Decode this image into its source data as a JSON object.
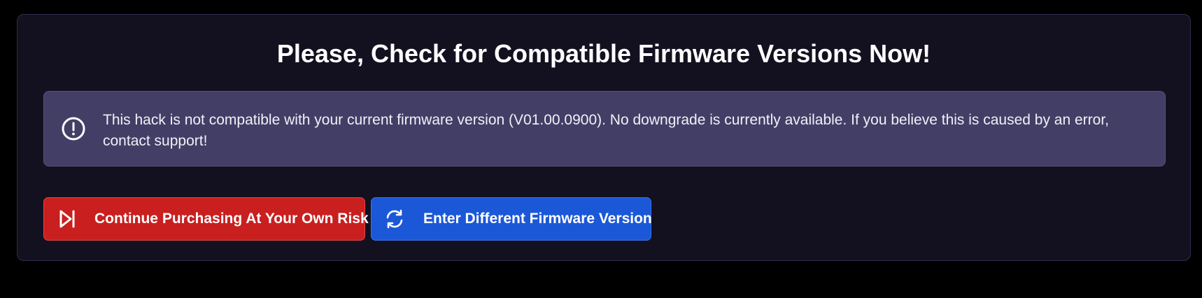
{
  "dialog": {
    "title": "Please, Check for Compatible Firmware Versions Now!",
    "alert": {
      "icon": "exclamation-circle-icon",
      "message": "This hack is not compatible with your current firmware version (V01.00.0900). No downgrade is currently available. If you believe this is caused by an error, contact support!"
    },
    "buttons": {
      "continue_label": "Continue Purchasing At Your Own Risk",
      "continue_icon": "skip-forward-icon",
      "enter_firmware_label": "Enter Different Firmware Version",
      "enter_firmware_icon": "refresh-icon"
    }
  },
  "colors": {
    "page_background": "#000000",
    "card_background": "#13111f",
    "alert_background": "#433e66",
    "danger_button": "#c91f1f",
    "primary_button": "#1b58d8"
  }
}
